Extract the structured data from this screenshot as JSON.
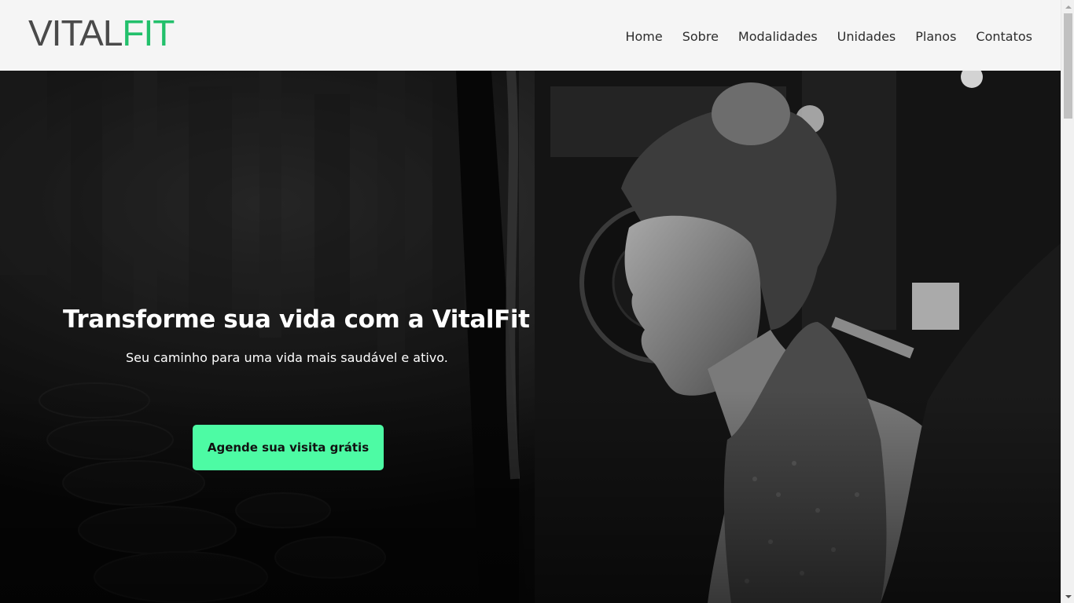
{
  "header": {
    "logo": {
      "part1": "VITAL",
      "part2": "FIT"
    },
    "nav": [
      {
        "label": "Home"
      },
      {
        "label": "Sobre"
      },
      {
        "label": "Modalidades"
      },
      {
        "label": "Unidades"
      },
      {
        "label": "Planos"
      },
      {
        "label": "Contatos"
      }
    ]
  },
  "hero": {
    "title": "Transforme sua vida com a VitalFit",
    "subtitle": "Seu caminho para uma vida mais saudável e ativo.",
    "cta_label": "Agende sua visita grátis",
    "image_description_icon": "gym-woman-photo"
  },
  "colors": {
    "brand_dark": "#4a4a4a",
    "brand_green": "#22c06b",
    "cta_bg": "#4dfba4",
    "header_bg": "#f5f5f5"
  }
}
